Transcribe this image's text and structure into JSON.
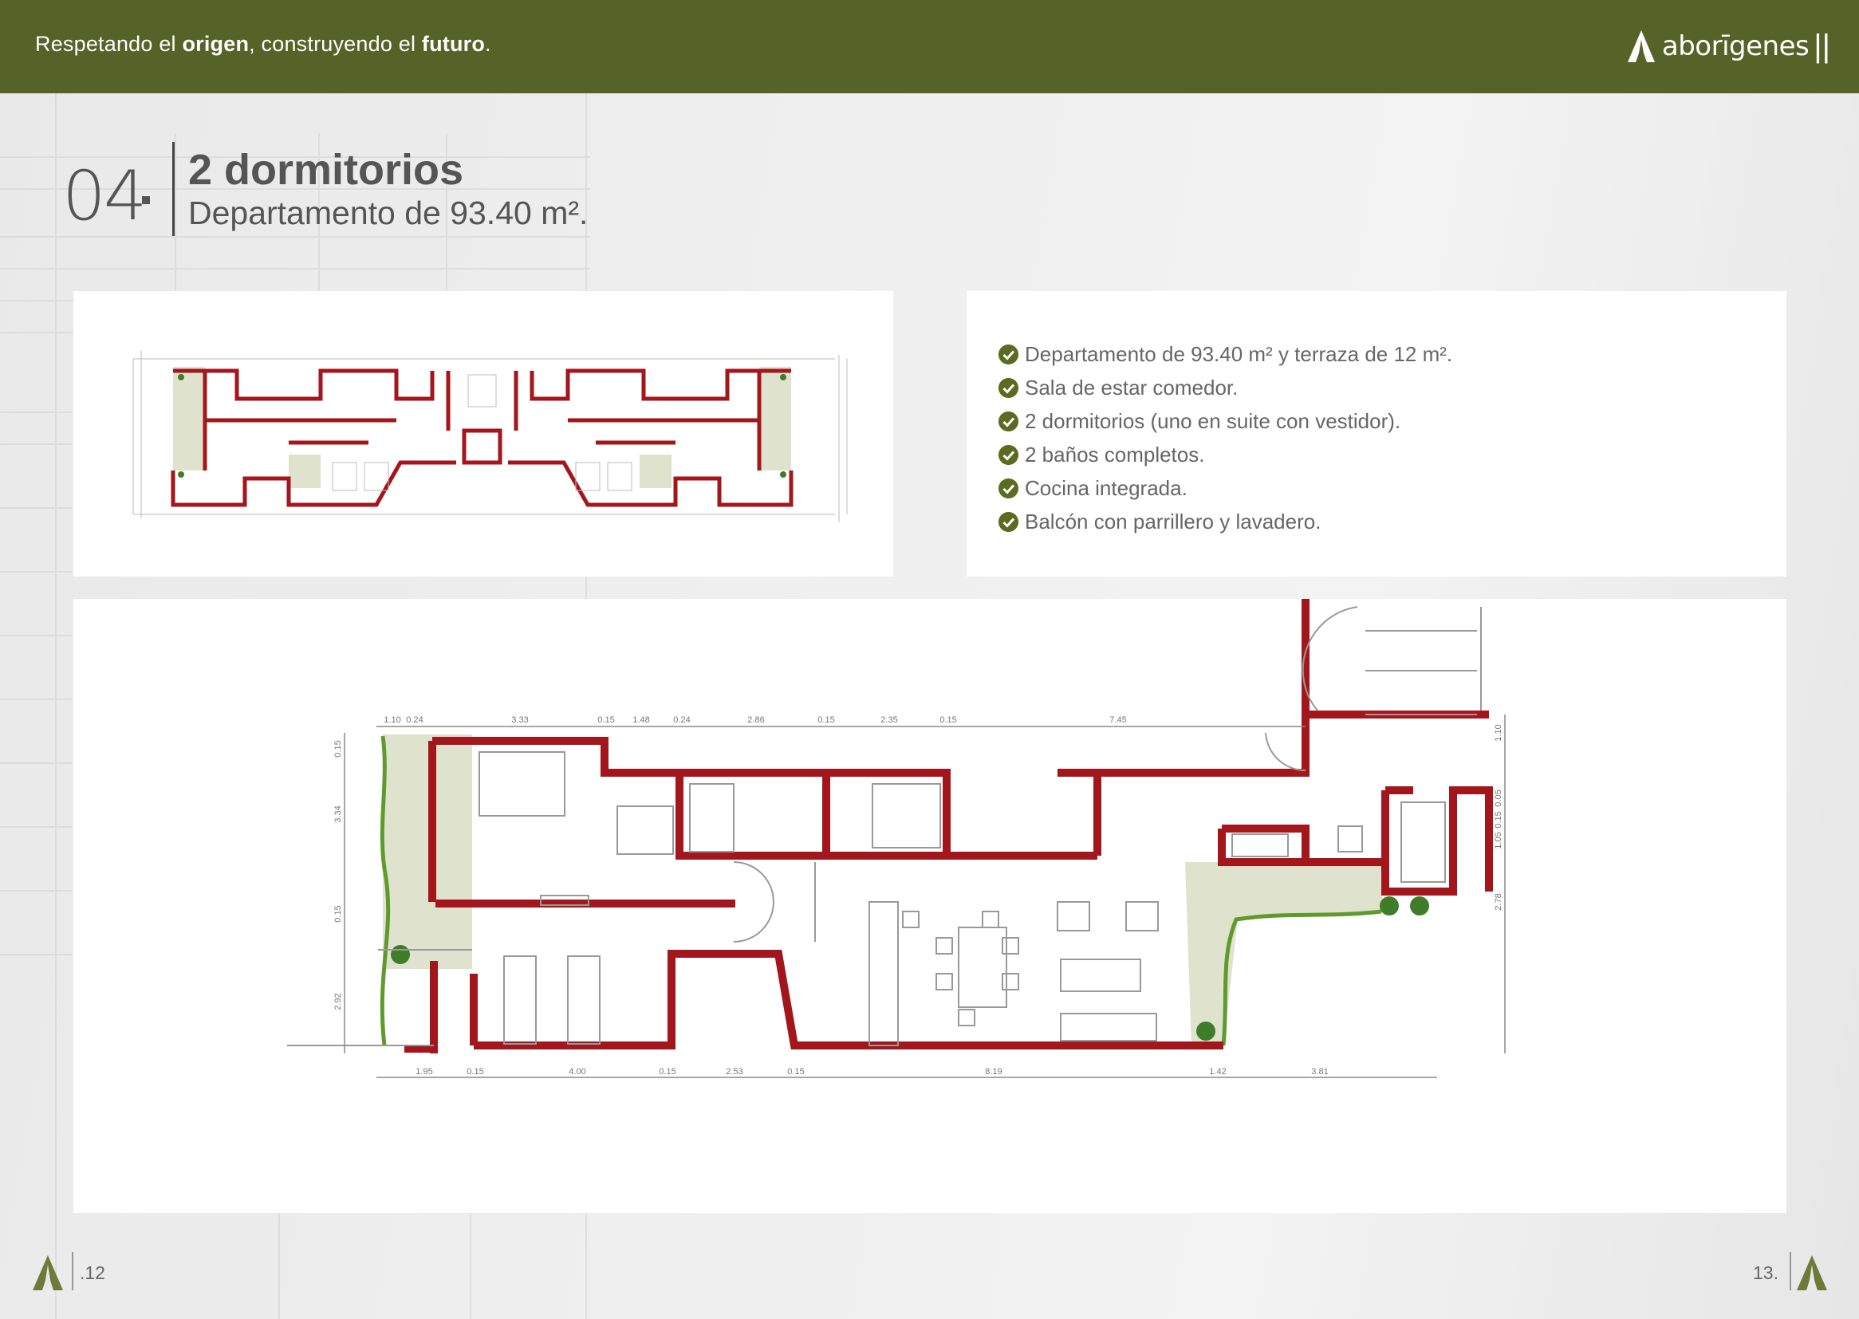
{
  "header": {
    "tagline_part1": "Respetando el ",
    "tagline_bold1": "origen",
    "tagline_part2": ", construyendo el ",
    "tagline_bold2": "futuro",
    "tagline_part3": ".",
    "logo_text": "aborīgenes",
    "logo_bars": "||"
  },
  "section": {
    "number": "04",
    "title": "2 dormitorios",
    "subtitle": "Departamento de 93.40 m²."
  },
  "features": [
    "Departamento de 93.40 m² y terraza de 12 m².",
    "Sala de estar comedor.",
    "2 dormitorios (uno en suite con vestidor).",
    "2 baños completos.",
    "Cocina integrada.",
    "Balcón con parrillero y lavadero."
  ],
  "plan_dimensions": {
    "top": [
      "1.10",
      "0.24",
      "3.33",
      "0.15",
      "1.48",
      "0.24",
      "2.86",
      "0.15",
      "2.35",
      "0.15",
      "7.45"
    ],
    "bottom": [
      "1.95",
      "0.15",
      "4.00",
      "0.15",
      "2.53",
      "0.15",
      "8.19",
      "1.42",
      "3.81"
    ],
    "left": [
      "0.15",
      "3.34",
      "0.15",
      "2.92"
    ],
    "right": [
      "1.10",
      "0.05",
      "0.15",
      "1.05",
      "2.78"
    ]
  },
  "footer": {
    "left_page": ".12",
    "right_page": "13."
  },
  "colors": {
    "header_green": "#566328",
    "wall_red": "#a3161b",
    "terrace_green": "#dfe3cd",
    "check_green": "#5b6b22"
  }
}
